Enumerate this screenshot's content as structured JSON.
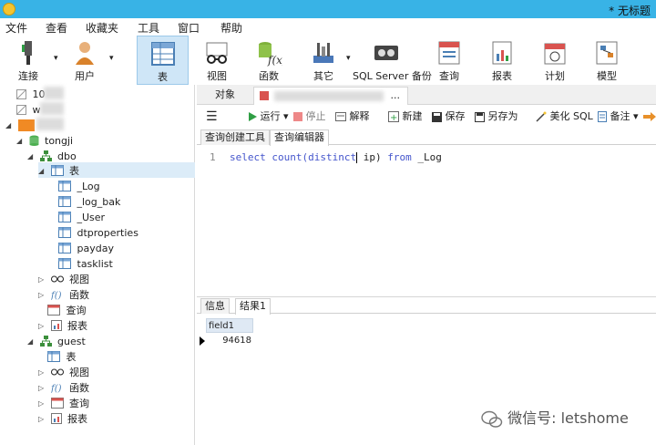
{
  "window": {
    "title": "* 无标题"
  },
  "menu": [
    "文件",
    "查看",
    "收藏夹",
    "工具",
    "窗口",
    "帮助"
  ],
  "toolbar": {
    "connect": "连接",
    "user": "用户",
    "table": "表",
    "view": "视图",
    "function": "函数",
    "other": "其它",
    "sqlserver_backup": "SQL Server 备份",
    "query": "查询",
    "report": "报表",
    "schedule": "计划",
    "model": "模型"
  },
  "tree": {
    "conn1": "10",
    "conn2": "w",
    "db": "tongji",
    "schema_dbo": "dbo",
    "tables_node": "表",
    "tables": [
      "_Log",
      "_log_bak",
      "_User",
      "dtproperties",
      "payday",
      "tasklist"
    ],
    "dbo_views": "视图",
    "dbo_functions": "函数",
    "dbo_queries": "查询",
    "dbo_reports": "报表",
    "schema_guest": "guest",
    "guest_tables": "表",
    "guest_views": "视图",
    "guest_functions": "函数",
    "guest_queries": "查询",
    "guest_reports": "报表"
  },
  "tabs": {
    "objects": "对象",
    "more": "..."
  },
  "query_toolbar": {
    "run": "运行",
    "stop": "停止",
    "explain": "解释",
    "new": "新建",
    "save": "保存",
    "save_as": "另存为",
    "beautify": "美化 SQL",
    "comment": "备注"
  },
  "subtabs": {
    "builder": "查询创建工具",
    "editor": "查询编辑器"
  },
  "editor": {
    "line_no": "1",
    "kw1": "select",
    "fn": "count(distinct",
    "arg": " ip)",
    "kw2": "from",
    "table": " _Log"
  },
  "result_tabs": {
    "info": "信息",
    "result1": "结果1"
  },
  "result": {
    "columns": [
      "field1"
    ],
    "rows": [
      [
        "94618"
      ]
    ]
  },
  "watermark": {
    "text": "微信号: letshome"
  }
}
